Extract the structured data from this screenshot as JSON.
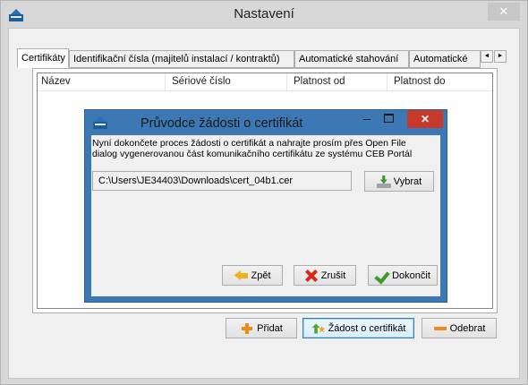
{
  "window": {
    "title": "Nastavení",
    "close_label": "✕"
  },
  "tabs": [
    {
      "label": "Certifikáty",
      "active": true
    },
    {
      "label": "Identifikační čísla (majitelů instalací / kontraktů)",
      "active": false
    },
    {
      "label": "Automatické stahování",
      "active": false
    },
    {
      "label": "Automatické",
      "active": false
    }
  ],
  "tab_scroll": {
    "left": "◄",
    "right": "►"
  },
  "certificate_list": {
    "columns": [
      "Název",
      "Sériové číslo",
      "Platnost od",
      "Platnost do"
    ],
    "rows": []
  },
  "footer_buttons": {
    "add": "Přidat",
    "request": "Žádost o certifikát",
    "remove": "Odebrat"
  },
  "wizard": {
    "title": "Průvodce žádosti o certifikát",
    "minimize_label": "–",
    "close_label": "✕",
    "instruction": "Nyní dokončete proces žádosti o certifikát a nahrajte prosím přes Open File\ndialog vygenerovanou část komunikačního certifikátu ze systému CEB Portál",
    "file_path": "C:\\Users\\JE34403\\Downloads\\cert_04b1.cer",
    "select_button": "Vybrat",
    "back_button": "Zpět",
    "cancel_button": "Zrušit",
    "finish_button": "Dokončit"
  },
  "icons": {
    "app": "app-icon",
    "add": "plus-icon",
    "request": "certificate-add-icon",
    "remove": "minus-icon",
    "select": "import-icon",
    "back": "arrow-left-icon",
    "cancel": "x-icon",
    "finish": "check-icon"
  },
  "colors": {
    "dialog_frame": "#3c78b4",
    "close_button": "#c7392b",
    "focus_border": "#3c7fb1",
    "accent_orange": "#f08a1c"
  }
}
